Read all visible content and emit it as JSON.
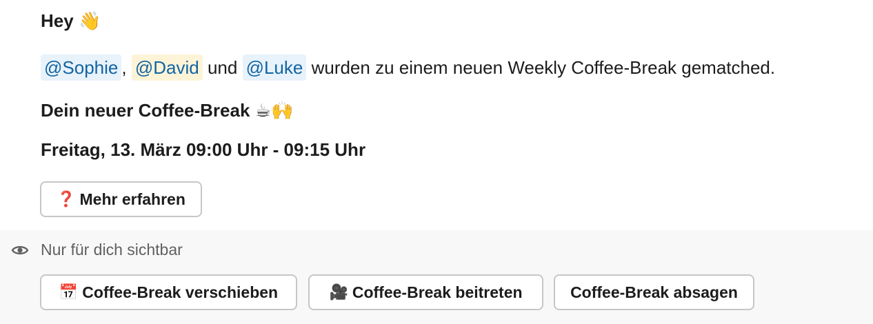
{
  "message": {
    "greeting": "Hey",
    "greeting_emoji": "👋",
    "mentions": [
      "@Sophie",
      "@David",
      "@Luke"
    ],
    "sep_comma": ",",
    "conj_und": "und",
    "body_rest": "wurden zu einem neuen Weekly Coffee-Break gematched.",
    "subtitle": "Dein neuer Coffee-Break",
    "subtitle_emojis": "☕🙌",
    "datetime": "Freitag, 13. März 09:00 Uhr - 09:15 Uhr"
  },
  "buttons": {
    "learn_more": {
      "icon": "question-mark-icon",
      "glyph": "❓",
      "label": "Mehr erfahren"
    }
  },
  "ephemeral": {
    "icon": "eye-icon",
    "label": "Nur für dich sichtbar",
    "actions": [
      {
        "icon": "calendar-icon",
        "glyph": "📅",
        "label": "Coffee-Break verschieben"
      },
      {
        "icon": "movie-camera-icon",
        "glyph": "🎥",
        "label": "Coffee-Break beitreten"
      },
      {
        "icon": "",
        "glyph": "",
        "label": "Coffee-Break absagen"
      }
    ]
  },
  "colors": {
    "mention_text": "#1264a3",
    "mention_bg": "#e8f2fa",
    "mention_highlight_bg": "#fdf4d8",
    "ephemeral_bg": "#f8f8f8"
  }
}
